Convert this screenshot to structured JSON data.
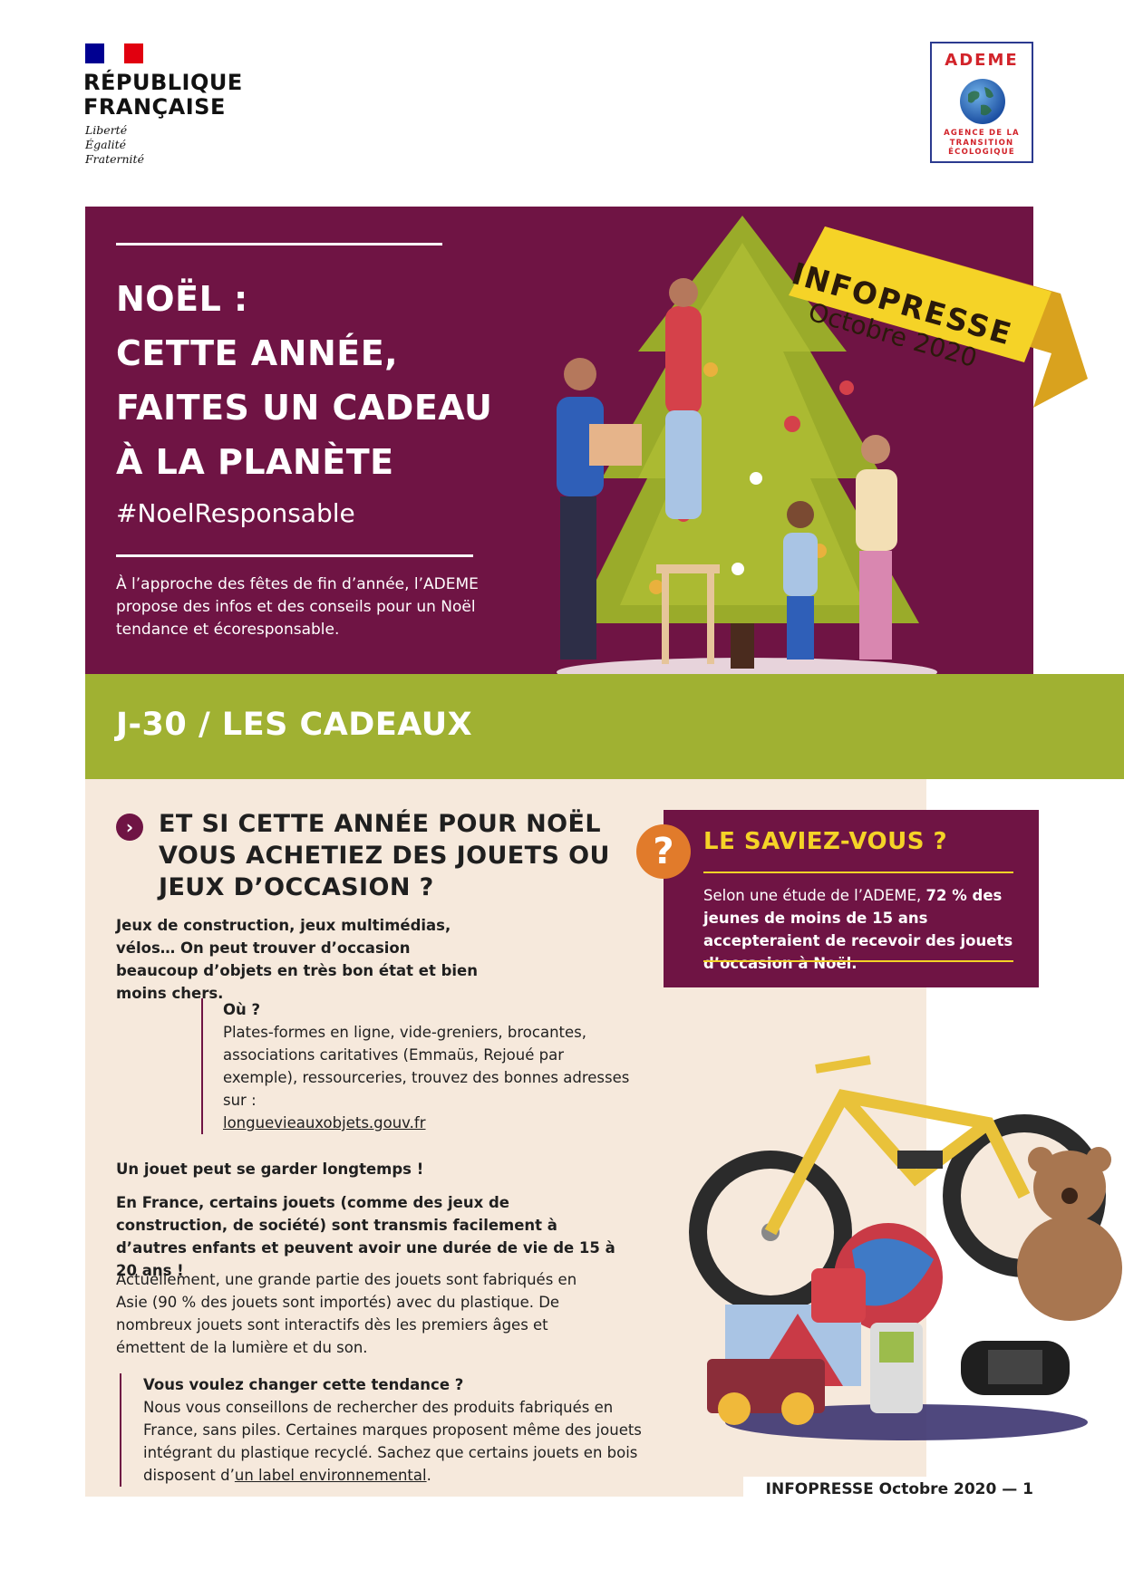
{
  "header": {
    "republic_name": [
      "RÉPUBLIQUE",
      "FRANÇAISE"
    ],
    "motto": [
      "Liberté",
      "Égalité",
      "Fraternité"
    ],
    "ademe": {
      "title": "ADEME",
      "subtitle": [
        "AGENCE DE LA",
        "TRANSITION",
        "ÉCOLOGIQUE"
      ]
    }
  },
  "hero": {
    "title_lines": [
      "NOËL :",
      "CETTE ANNÉE,",
      "FAITES UN CADEAU",
      "À LA PLANÈTE"
    ],
    "hashtag": "#NoelResponsable",
    "intro": "À l’approche des fêtes de fin d’année, l’ADEME propose des infos et des conseils pour un Noël tendance et écoresponsable.",
    "ribbon_line1": "INFOPRESSE",
    "ribbon_line2": "Octobre 2020"
  },
  "band": {
    "title": "J-30 / LES CADEAUX"
  },
  "article": {
    "question_title": "ET SI CETTE ANNÉE POUR NOËL VOUS ACHETIEZ DES JOUETS OU JEUX D’OCCASION ?",
    "lead": "Jeux de construction, jeux multimédias, vélos… On peut trouver d’occasion beaucoup d’objets en très bon état et bien moins chers.",
    "where_heading": "Où ?",
    "where_text": "Plates-formes en ligne, vide-greniers, brocantes, associations caritatives (Emmaüs, Rejoué par exemple), ressourceries, trouvez des bonnes adresses sur :",
    "where_link": "longuevieauxobjets.gouv.fr",
    "keep_heading": "Un jouet peut se garder longtemps !",
    "keep_text": "En France, certains jouets (comme des jeux de construction, de société) sont transmis facilement à d’autres enfants et peuvent avoir une durée de vie de 15 à 20 ans !",
    "asia_text": "Actuellement, une grande partie des jouets sont fabriqués en Asie (90 % des jouets sont importés) avec du plastique. De nombreux jouets sont interactifs dès les premiers âges et émettent de la lumière et du son.",
    "trend_heading": "Vous voulez changer cette tendance ?",
    "trend_text": "Nous vous conseillons de rechercher des produits fabriqués en France, sans piles. Certaines marques proposent même des jouets intégrant du plastique recyclé. Sachez que certains jouets en bois disposent d’",
    "trend_link": "un label environnemental",
    "trend_end": "."
  },
  "saviez": {
    "title": "LE SAVIEZ-VOUS ?",
    "text_pre": "Selon une étude de l’ADEME, ",
    "text_bold": "72 % des jeunes de moins de 15 ans accepteraient de recevoir des jouets d’occasion à Noël."
  },
  "footer": {
    "text": "INFOPRESSE Octobre 2020 — 1"
  },
  "colors": {
    "plum": "#6f1444",
    "green": "#a0b132",
    "beige": "#f6e9dc",
    "yellow": "#f5d327",
    "orange": "#e17b2b"
  }
}
